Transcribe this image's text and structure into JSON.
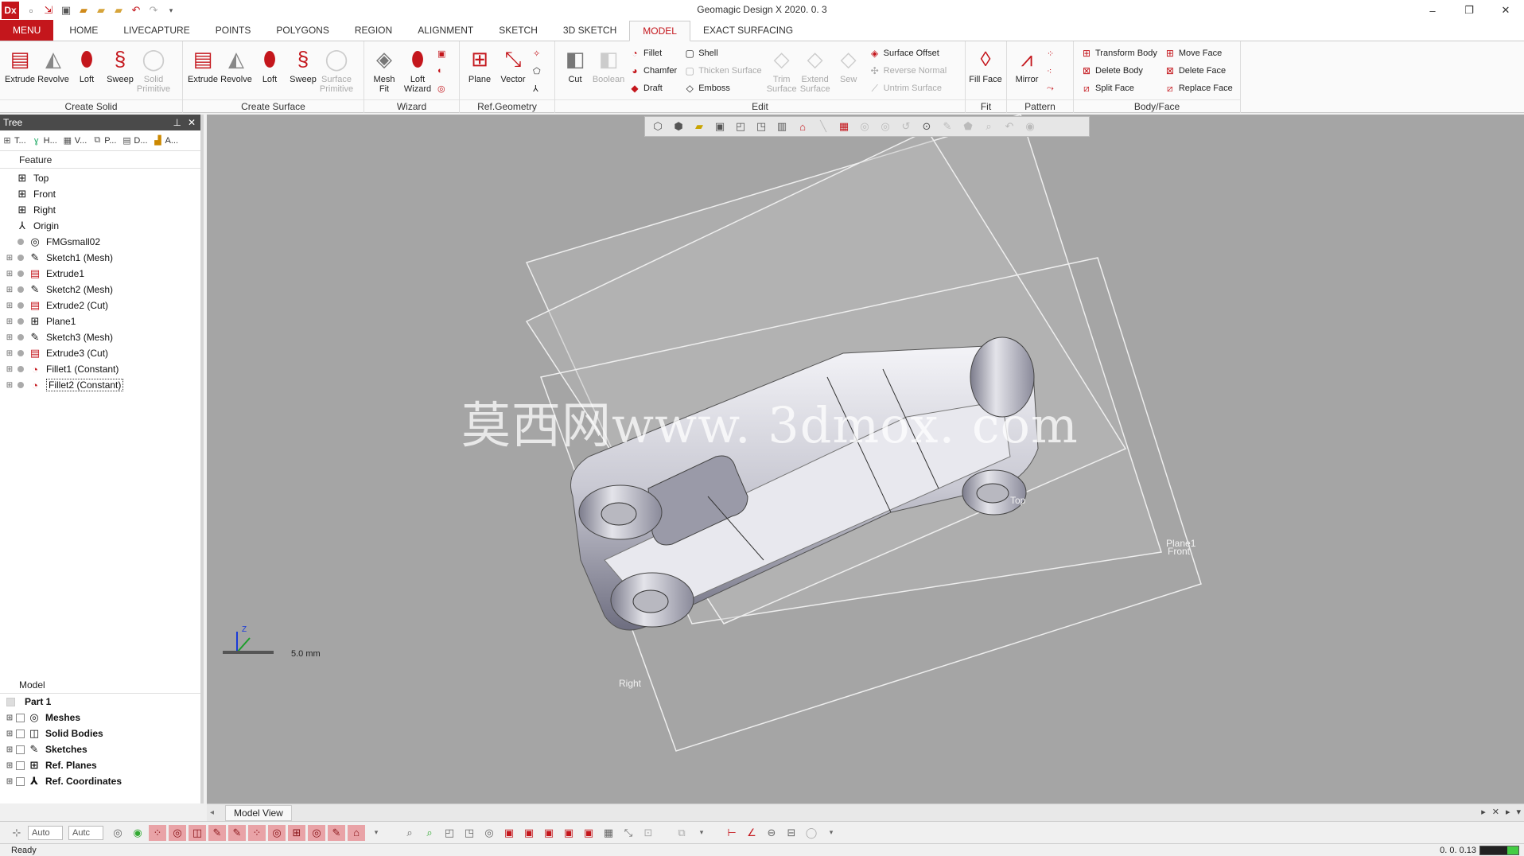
{
  "app": {
    "logo": "Dx",
    "title": "Geomagic Design X 2020. 0. 3"
  },
  "quick_access": [
    "new-icon",
    "open-icon",
    "save-icon",
    "import-icon",
    "folder-icon",
    "folder-open-icon",
    "undo-icon",
    "redo-icon",
    "dropdown-icon"
  ],
  "tabs": [
    {
      "label": "MENU"
    },
    {
      "label": "HOME"
    },
    {
      "label": "LIVECAPTURE"
    },
    {
      "label": "POINTS"
    },
    {
      "label": "POLYGONS"
    },
    {
      "label": "REGION"
    },
    {
      "label": "ALIGNMENT"
    },
    {
      "label": "SKETCH"
    },
    {
      "label": "3D SKETCH"
    },
    {
      "label": "MODEL"
    },
    {
      "label": "EXACT SURFACING"
    }
  ],
  "ribbon": {
    "create_solid": {
      "label": "Create Solid",
      "extrude": "Extrude",
      "revolve": "Revolve",
      "loft": "Loft",
      "sweep": "Sweep",
      "primitive": "Solid Primitive"
    },
    "create_surface": {
      "label": "Create Surface",
      "extrude": "Extrude",
      "revolve": "Revolve",
      "loft": "Loft",
      "sweep": "Sweep",
      "primitive": "Surface Primitive"
    },
    "wizard": {
      "label": "Wizard",
      "mesh_fit": "Mesh Fit",
      "loft_wizard": "Loft Wizard"
    },
    "ref_geometry": {
      "label": "Ref.Geometry",
      "plane": "Plane",
      "vector": "Vector"
    },
    "edit": {
      "label": "Edit",
      "cut": "Cut",
      "boolean": "Boolean",
      "fillet": "Fillet",
      "chamfer": "Chamfer",
      "draft": "Draft",
      "shell": "Shell",
      "thicken": "Thicken Surface",
      "emboss": "Emboss",
      "trim": "Trim Surface",
      "extend": "Extend Surface",
      "sew": "Sew",
      "offset": "Surface Offset",
      "reverse": "Reverse Normal",
      "untrim": "Untrim Surface"
    },
    "fit": {
      "label": "Fit",
      "fill_face": "Fill Face"
    },
    "pattern": {
      "label": "Pattern",
      "mirror": "Mirror"
    },
    "body_face": {
      "label": "Body/Face",
      "transform": "Transform Body",
      "delete_body": "Delete Body",
      "split": "Split Face",
      "move": "Move Face",
      "delete_face": "Delete Face",
      "replace": "Replace Face"
    }
  },
  "tree": {
    "title": "Tree",
    "tabs": [
      "T...",
      "H...",
      "V...",
      "P...",
      "D...",
      "A..."
    ],
    "feature_header": "Feature",
    "items": [
      {
        "label": "Top",
        "icon": "plane-icon"
      },
      {
        "label": "Front",
        "icon": "plane-icon"
      },
      {
        "label": "Right",
        "icon": "plane-icon"
      },
      {
        "label": "Origin",
        "icon": "origin-icon"
      },
      {
        "label": "FMGsmall02",
        "icon": "mesh-icon"
      },
      {
        "label": "Sketch1 (Mesh)",
        "icon": "sketch-icon"
      },
      {
        "label": "Extrude1",
        "icon": "extrude-icon"
      },
      {
        "label": "Sketch2 (Mesh)",
        "icon": "sketch-icon"
      },
      {
        "label": "Extrude2 (Cut)",
        "icon": "extrude-icon"
      },
      {
        "label": "Plane1",
        "icon": "plane-icon"
      },
      {
        "label": "Sketch3 (Mesh)",
        "icon": "sketch-icon"
      },
      {
        "label": "Extrude3 (Cut)",
        "icon": "extrude-icon"
      },
      {
        "label": "Fillet1 (Constant)",
        "icon": "fillet-icon"
      },
      {
        "label": "Fillet2 (Constant)",
        "icon": "fillet-icon"
      }
    ],
    "model_header": "Model",
    "part": "Part 1",
    "model_items": [
      {
        "label": "Meshes"
      },
      {
        "label": "Solid Bodies"
      },
      {
        "label": "Sketches"
      },
      {
        "label": "Ref. Planes"
      },
      {
        "label": "Ref. Coordinates"
      }
    ]
  },
  "viewport": {
    "planes": {
      "top": "Top",
      "front": "Front",
      "plane1": "Plane1",
      "right": "Right"
    },
    "watermark": "莫西网www. 3dmox. com",
    "scale": "5.0 mm",
    "axis": "Z"
  },
  "model_view_tab": "Model View",
  "bottom_toolbar": {
    "auto1": "Auto",
    "auto2": "Autc"
  },
  "status": {
    "text": "Ready",
    "coords": "0. 0. 0.13"
  }
}
